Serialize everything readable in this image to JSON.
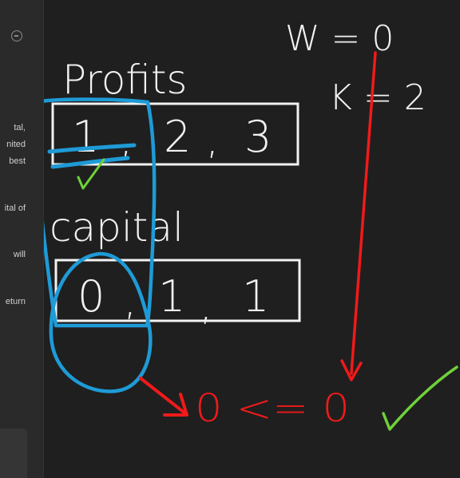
{
  "sidebar": {
    "fragments": [
      "tal,",
      "nited",
      "best",
      "ital of",
      "will",
      "eturn"
    ]
  },
  "whiteboard": {
    "w_equation": "W = 0",
    "k_equation": "K = 2",
    "profits_label": "Profits",
    "profits_values": [
      "1",
      "2",
      "3"
    ],
    "capital_label": "capital",
    "capital_values": [
      "0",
      "1",
      "1"
    ],
    "comparison_text": "0 <= 0",
    "colors": {
      "ink_white": "#f2f2f2",
      "ink_blue": "#1e9bd7",
      "ink_red": "#f01a1a",
      "ink_green": "#6fd13a"
    }
  }
}
